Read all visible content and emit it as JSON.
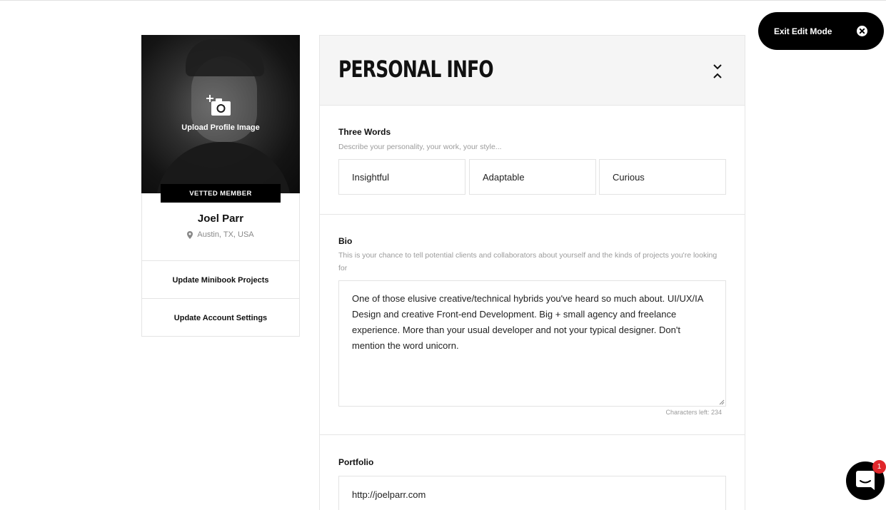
{
  "header": {
    "exit_edit_label": "Exit Edit Mode"
  },
  "profile": {
    "upload_label": "Upload Profile Image",
    "badge": "VETTED MEMBER",
    "name": "Joel Parr",
    "location": "Austin, TX, USA",
    "links": [
      {
        "label": "Update Minibook Projects"
      },
      {
        "label": "Update Account Settings"
      }
    ]
  },
  "panel": {
    "title": "PERSONAL INFO",
    "three_words": {
      "label": "Three Words",
      "help": "Describe your personality, your work, your style...",
      "values": [
        "Insightful",
        "Adaptable",
        "Curious"
      ]
    },
    "bio": {
      "label": "Bio",
      "help": "This is your chance to tell potential clients and collaborators about yourself and the kinds of projects you're looking for",
      "value": "One of those elusive creative/technical hybrids you've heard so much about. UI/UX/IA Design and creative Front-end Development. Big + small agency and freelance experience. More than your usual developer and not your typical designer. Don't mention the word unicorn.",
      "chars_left": "Characters left: 234"
    },
    "portfolio": {
      "label": "Portfolio",
      "value": "http://joelparr.com"
    }
  },
  "chat": {
    "badge_count": "1"
  },
  "colors": {
    "accent_black": "#000000",
    "badge_red": "#e0262a",
    "header_bg": "#f5f5f5",
    "help_text": "#9b9b9b"
  },
  "icons": [
    "close-circle-icon",
    "camera-plus-icon",
    "location-pin-icon",
    "collapse-chevrons-icon",
    "chat-icon"
  ]
}
